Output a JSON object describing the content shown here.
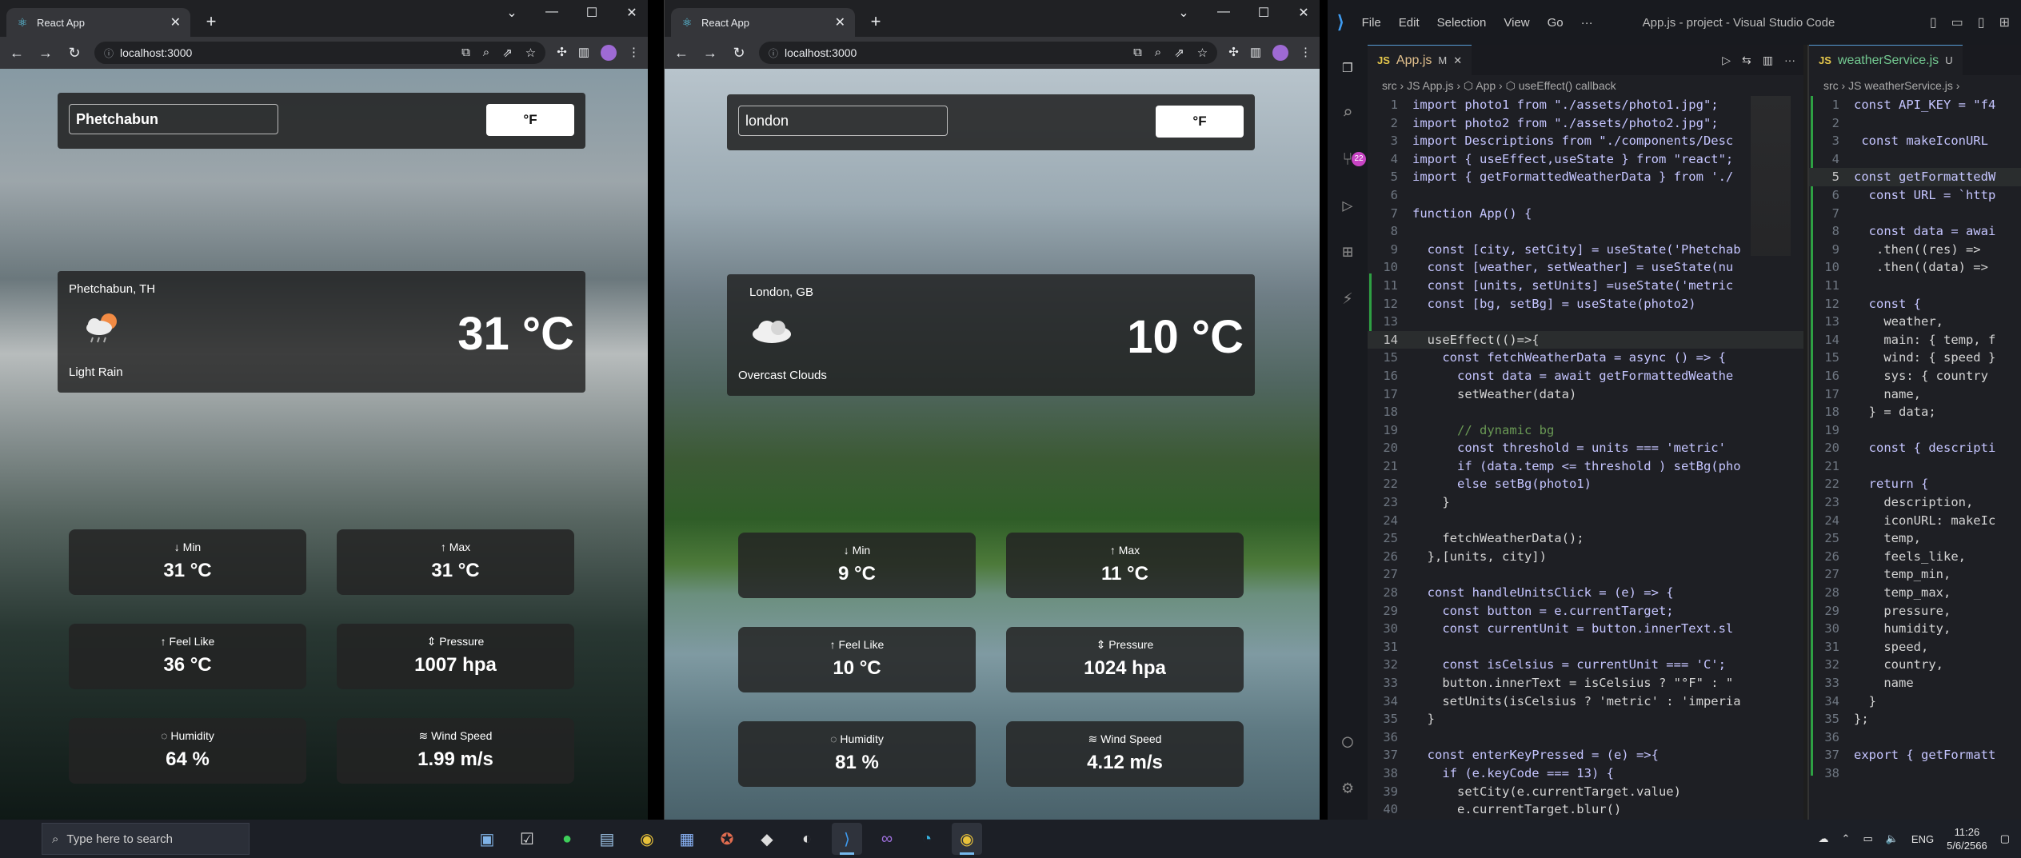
{
  "browser_left": {
    "tab_title": "React App",
    "url": "localhost:3000",
    "city_input": "Phetchabun",
    "unit_button": "°F",
    "location": "Phetchabun, TH",
    "description": "Light Rain",
    "temp": "31 °C",
    "cards": [
      {
        "label": "Min",
        "arrow": "↓",
        "value": "31 °C"
      },
      {
        "label": "Max",
        "arrow": "↑",
        "value": "31 °C"
      },
      {
        "label": "Feel Like",
        "arrow": "↑",
        "value": "36 °C"
      },
      {
        "label": "Pressure",
        "arrow": "⇕",
        "value": "1007 hpa"
      },
      {
        "label": "Humidity",
        "arrow": "◌",
        "value": "64 %"
      },
      {
        "label": "Wind Speed",
        "arrow": "≋",
        "value": "1.99 m/s"
      }
    ]
  },
  "browser_right": {
    "tab_title": "React App",
    "url": "localhost:3000",
    "city_input": "london",
    "unit_button": "°F",
    "location": "London, GB",
    "description": "Overcast Clouds",
    "temp": "10 °C",
    "cards": [
      {
        "label": "Min",
        "arrow": "↓",
        "value": "9 °C"
      },
      {
        "label": "Max",
        "arrow": "↑",
        "value": "11 °C"
      },
      {
        "label": "Feel Like",
        "arrow": "↑",
        "value": "10 °C"
      },
      {
        "label": "Pressure",
        "arrow": "⇕",
        "value": "1024 hpa"
      },
      {
        "label": "Humidity",
        "arrow": "◌",
        "value": "81 %"
      },
      {
        "label": "Wind Speed",
        "arrow": "≋",
        "value": "4.12 m/s"
      }
    ]
  },
  "vscode": {
    "menu": [
      "File",
      "Edit",
      "Selection",
      "View",
      "Go",
      "···"
    ],
    "window_title": "App.js - project - Visual Studio Code",
    "scm_badge": "22",
    "tab1": {
      "name": "App.js",
      "status": "M"
    },
    "tab2": {
      "name": "weatherService.js",
      "status": "U"
    },
    "crumbs1": "src › JS App.js › ⬡ App › ⬡ useEffect() callback",
    "crumbs2": "src › JS weatherService.js ›",
    "code1": [
      "import photo1 from \"./assets/photo1.jpg\";",
      "import photo2 from \"./assets/photo2.jpg\";",
      "import Descriptions from \"./components/Desc",
      "import { useEffect,useState } from \"react\";",
      "import { getFormattedWeatherData } from './",
      "",
      "function App() {",
      "",
      "  const [city, setCity] = useState('Phetchab",
      "  const [weather, setWeather] = useState(nu",
      "  const [units, setUnits] =useState('metric",
      "  const [bg, setBg] = useState(photo2)",
      "",
      "  useEffect(()=>{",
      "    const fetchWeatherData = async () => {",
      "      const data = await getFormattedWeathe",
      "      setWeather(data)",
      "",
      "      // dynamic bg",
      "      const threshold = units === 'metric'",
      "      if (data.temp <= threshold ) setBg(pho",
      "      else setBg(photo1)",
      "    }",
      "",
      "    fetchWeatherData();",
      "  },[units, city])",
      "",
      "  const handleUnitsClick = (e) => {",
      "    const button = e.currentTarget;",
      "    const currentUnit = button.innerText.sl",
      "",
      "    const isCelsius = currentUnit === 'C';",
      "    button.innerText = isCelsius ? \"°F\" : \"",
      "    setUnits(isCelsius ? 'metric' : 'imperia",
      "  }",
      "",
      "  const enterKeyPressed = (e) =>{",
      "    if (e.keyCode === 13) {",
      "      setCity(e.currentTarget.value)",
      "      e.currentTarget.blur()"
    ],
    "code2": [
      "const API_KEY = \"f4",
      "",
      " const makeIconURL",
      "",
      "const getFormattedW",
      "  const URL = `http",
      "",
      "  const data = awai",
      "   .then((res) =>",
      "   .then((data) =>",
      "",
      "  const {",
      "    weather,",
      "    main: { temp, f",
      "    wind: { speed }",
      "    sys: { country",
      "    name,",
      "  } = data;",
      "",
      "  const { descripti",
      "",
      "  return {",
      "    description,",
      "    iconURL: makeIc",
      "    temp,",
      "    feels_like,",
      "    temp_min,",
      "    temp_max,",
      "    pressure,",
      "    humidity,",
      "    speed,",
      "    country,",
      "    name",
      "  }",
      "};",
      "",
      "export { getFormatt",
      ""
    ]
  },
  "taskbar": {
    "search_placeholder": "Type here to search",
    "lang": "ENG",
    "time": "11:26",
    "date": "5/6/2566"
  }
}
